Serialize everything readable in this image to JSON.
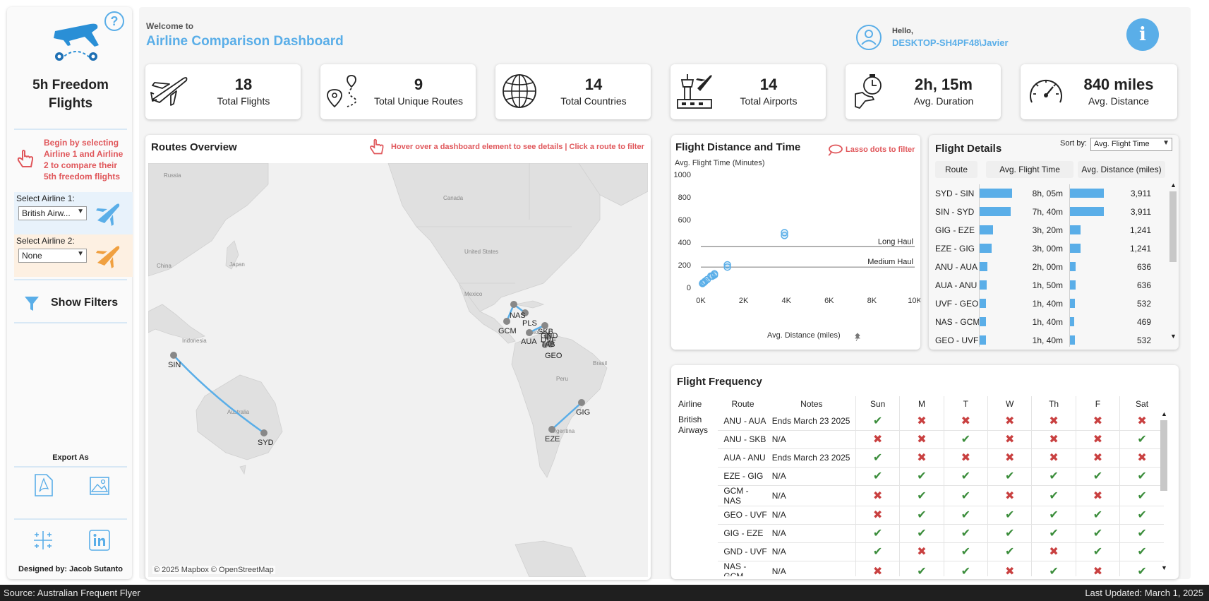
{
  "sidebar": {
    "title": "5h Freedom Flights",
    "instruction": "Begin by selecting Airline 1 and Airline 2 to compare their 5th freedom flights",
    "airline1_label": "Select Airline 1:",
    "airline1_value": "British Airw...",
    "airline2_label": "Select Airline 2:",
    "airline2_value": "None",
    "show_filters": "Show Filters",
    "export_label": "Export As",
    "designer": "Designed by: Jacob Sutanto"
  },
  "header": {
    "welcome": "Welcome to",
    "title": "Airline Comparison Dashboard",
    "hello": "Hello,",
    "user": "DESKTOP-SH4PF48\\Javier"
  },
  "kpis": [
    {
      "value": "18",
      "label": "Total Flights",
      "icon": "airplane-icon"
    },
    {
      "value": "9",
      "label": "Total Unique Routes",
      "icon": "route-icon"
    },
    {
      "value": "14",
      "label": "Total Countries",
      "icon": "globe-icon"
    },
    {
      "value": "14",
      "label": "Total Airports",
      "icon": "airport-icon"
    },
    {
      "value": "2h, 15m",
      "label": "Avg. Duration",
      "icon": "timer-icon"
    },
    {
      "value": "840 miles",
      "label": "Avg. Distance",
      "icon": "speedometer-icon"
    }
  ],
  "routes_overview": {
    "title": "Routes Overview",
    "hint": "Hover over a dashboard element to see details | Click a route to filter",
    "attribution": "© 2025 Mapbox © OpenStreetMap",
    "place_labels": [
      "Russia",
      "Canada",
      "China",
      "Japan",
      "United States",
      "Mexico",
      "Indonesia",
      "Colombia",
      "Peru",
      "Brasil",
      "Australia",
      "Argentina"
    ],
    "airport_labels": [
      "SIN",
      "SYD",
      "NAS",
      "PLS",
      "GCM",
      "AUA",
      "SKB",
      "GND",
      "UVF",
      "TAB",
      "GEO",
      "GIG",
      "EZE"
    ]
  },
  "scatter": {
    "title": "Flight Distance and Time",
    "hint": "Lasso dots to filter",
    "ylabel": "Avg. Flight Time (Minutes)",
    "xlabel": "Avg. Distance (miles)",
    "ref_long": "Long Haul",
    "ref_medium": "Medium Haul"
  },
  "chart_data": {
    "type": "scatter",
    "title": "Flight Distance and Time",
    "xlabel": "Avg. Distance (miles)",
    "ylabel": "Avg. Flight Time (Minutes)",
    "xlim": [
      0,
      10000
    ],
    "ylim": [
      0,
      1000
    ],
    "x_ticks": [
      "0K",
      "2K",
      "4K",
      "6K",
      "8K",
      "10K"
    ],
    "y_ticks": [
      "0",
      "200",
      "400",
      "600",
      "800",
      "1000"
    ],
    "reference_lines": [
      {
        "label": "Long Haul",
        "y": 360
      },
      {
        "label": "Medium Haul",
        "y": 180
      }
    ],
    "grid": false,
    "points": [
      {
        "x": 3911,
        "y": 485
      },
      {
        "x": 3911,
        "y": 460
      },
      {
        "x": 1241,
        "y": 200
      },
      {
        "x": 1241,
        "y": 180
      },
      {
        "x": 636,
        "y": 120
      },
      {
        "x": 636,
        "y": 110
      },
      {
        "x": 532,
        "y": 100
      },
      {
        "x": 469,
        "y": 100
      },
      {
        "x": 532,
        "y": 100
      },
      {
        "x": 300,
        "y": 70
      },
      {
        "x": 200,
        "y": 55
      },
      {
        "x": 150,
        "y": 45
      },
      {
        "x": 100,
        "y": 40
      },
      {
        "x": 80,
        "y": 35
      }
    ]
  },
  "flight_details": {
    "title": "Flight Details",
    "sort_label": "Sort by:",
    "sort_value": "Avg. Flight Time",
    "columns": [
      "Route",
      "Avg. Flight Time",
      "Avg. Distance (miles)"
    ],
    "max_time_min": 485,
    "max_distance": 3911,
    "rows": [
      {
        "route": "SYD - SIN",
        "time": "8h, 05m",
        "time_min": 485,
        "dist": "3,911",
        "dist_val": 3911
      },
      {
        "route": "SIN - SYD",
        "time": "7h, 40m",
        "time_min": 460,
        "dist": "3,911",
        "dist_val": 3911
      },
      {
        "route": "GIG - EZE",
        "time": "3h, 20m",
        "time_min": 200,
        "dist": "1,241",
        "dist_val": 1241
      },
      {
        "route": "EZE - GIG",
        "time": "3h, 00m",
        "time_min": 180,
        "dist": "1,241",
        "dist_val": 1241
      },
      {
        "route": "ANU - AUA",
        "time": "2h, 00m",
        "time_min": 120,
        "dist": "636",
        "dist_val": 636
      },
      {
        "route": "AUA - ANU",
        "time": "1h, 50m",
        "time_min": 110,
        "dist": "636",
        "dist_val": 636
      },
      {
        "route": "UVF - GEO",
        "time": "1h, 40m",
        "time_min": 100,
        "dist": "532",
        "dist_val": 532
      },
      {
        "route": "NAS - GCM",
        "time": "1h, 40m",
        "time_min": 100,
        "dist": "469",
        "dist_val": 469
      },
      {
        "route": "GEO - UVF",
        "time": "1h, 40m",
        "time_min": 100,
        "dist": "532",
        "dist_val": 532
      }
    ]
  },
  "flight_frequency": {
    "title": "Flight Frequency",
    "columns": [
      "Airline",
      "Route",
      "Notes",
      "Sun",
      "M",
      "T",
      "W",
      "Th",
      "F",
      "Sat"
    ],
    "airline": "British Airways",
    "rows": [
      {
        "route": "ANU - AUA",
        "notes": "Ends March 23 2025",
        "days": [
          1,
          0,
          0,
          0,
          0,
          0,
          0
        ]
      },
      {
        "route": "ANU - SKB",
        "notes": "N/A",
        "days": [
          0,
          0,
          1,
          0,
          0,
          0,
          1
        ]
      },
      {
        "route": "AUA - ANU",
        "notes": "Ends March 23 2025",
        "days": [
          1,
          0,
          0,
          0,
          0,
          0,
          0
        ]
      },
      {
        "route": "EZE - GIG",
        "notes": "N/A",
        "days": [
          1,
          1,
          1,
          1,
          1,
          1,
          1
        ]
      },
      {
        "route": "GCM - NAS",
        "notes": "N/A",
        "days": [
          0,
          1,
          1,
          0,
          1,
          0,
          1
        ]
      },
      {
        "route": "GEO - UVF",
        "notes": "N/A",
        "days": [
          0,
          1,
          1,
          1,
          1,
          1,
          1
        ]
      },
      {
        "route": "GIG - EZE",
        "notes": "N/A",
        "days": [
          1,
          1,
          1,
          1,
          1,
          1,
          1
        ]
      },
      {
        "route": "GND - UVF",
        "notes": "N/A",
        "days": [
          1,
          0,
          1,
          1,
          0,
          1,
          1
        ]
      },
      {
        "route": "NAS - GCM",
        "notes": "N/A",
        "days": [
          0,
          1,
          1,
          0,
          1,
          0,
          1
        ]
      }
    ]
  },
  "footer": {
    "source": "Source: Australian Frequent Flyer",
    "updated": "Last Updated: March 1, 2025"
  },
  "colors": {
    "accent": "#5aaee8",
    "hint_red": "#e0575b",
    "airline2": "#f0a040",
    "check": "#3b8d3b",
    "cross": "#c94040"
  }
}
